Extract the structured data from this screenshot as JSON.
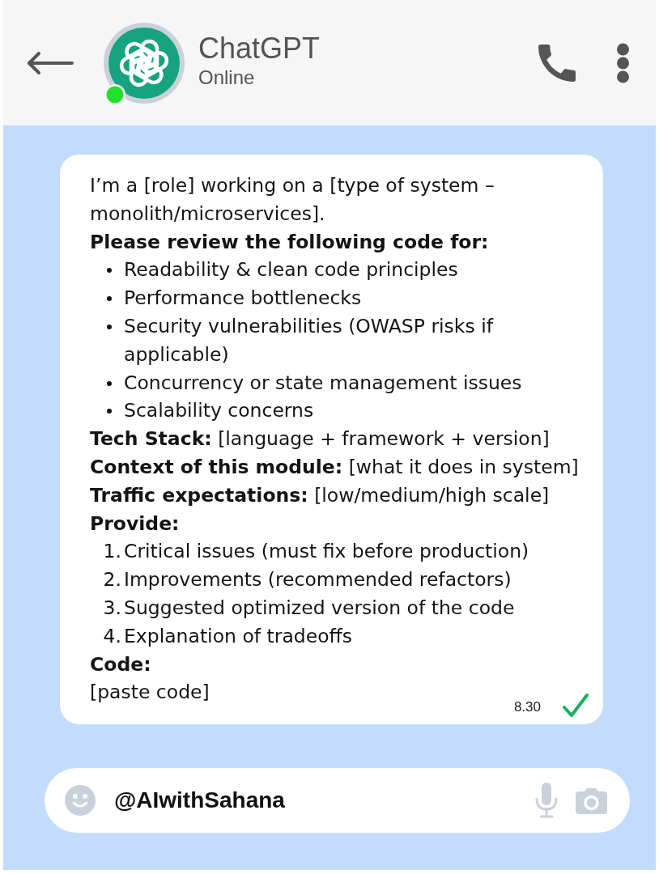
{
  "header": {
    "title": "ChatGPT",
    "status": "Online",
    "online": true
  },
  "message": {
    "blocks": [
      {
        "kind": "text",
        "text": "I’m a [role] working on a [type of system – monolith/microservices]."
      },
      {
        "kind": "heading",
        "text": "Please review the following code for:"
      },
      {
        "kind": "bullets",
        "items": [
          "Readability & clean code principles",
          "Performance bottlenecks",
          "Security vulnerabilities (OWASP risks if applicable)",
          "Concurrency or state management issues",
          "Scalability concerns"
        ]
      },
      {
        "kind": "text",
        "text": "**Tech Stack:** [language + framework + version]"
      },
      {
        "kind": "text",
        "text": "**Context of this module:** [what it does in system]"
      },
      {
        "kind": "text",
        "text": "**Traffic expectations:** [low/medium/high scale]"
      },
      {
        "kind": "heading",
        "text": "Provide:"
      },
      {
        "kind": "numbered",
        "items": [
          {
            "number": "1.",
            "text": "Critical issues (must fix before production)"
          },
          {
            "number": "2.",
            "text": "Improvements (recommended refactors)"
          },
          {
            "number": "3.",
            "text": "Suggested optimized version of the code"
          },
          {
            "number": "4.",
            "text": "Explanation of tradeoffs"
          }
        ]
      },
      {
        "kind": "heading",
        "text": "Code:"
      },
      {
        "kind": "text",
        "text": "[paste code]"
      }
    ],
    "time": "8.30",
    "read": true
  },
  "composer": {
    "value": "@AIwithSahana"
  }
}
